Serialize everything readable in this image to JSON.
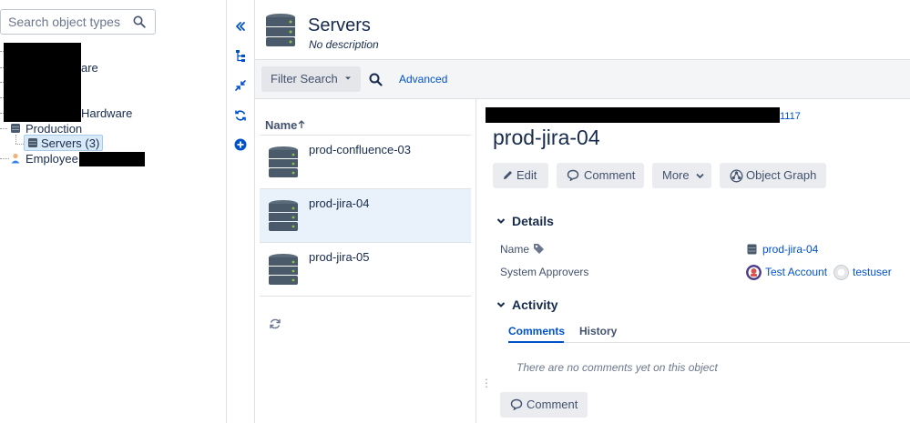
{
  "tree": {
    "search_placeholder": "Search object types",
    "nodes": {
      "partial_1": "are",
      "partial_2": "Hardware",
      "production": "Production",
      "servers": "Servers (3)",
      "employee": "Employee"
    }
  },
  "icon_column": {
    "icons": [
      "collapse-left-icon",
      "hierarchy-icon",
      "compress-icon",
      "sync-icon",
      "add-circle-icon"
    ]
  },
  "header": {
    "title": "Servers",
    "description": "No description"
  },
  "filter_bar": {
    "filter_label": "Filter Search",
    "advanced_label": "Advanced"
  },
  "list": {
    "column_header": "Name",
    "items": [
      {
        "label": "prod-confluence-03"
      },
      {
        "label": "prod-jira-04"
      },
      {
        "label": "prod-jira-05"
      }
    ]
  },
  "detail": {
    "key_suffix": "1117",
    "title": "prod-jira-04",
    "buttons": {
      "edit": "Edit",
      "comment": "Comment",
      "more": "More",
      "object_graph": "Object Graph"
    },
    "details_section": {
      "title": "Details",
      "name_label": "Name",
      "name_value": "prod-jira-04",
      "approvers_label": "System Approvers",
      "approver_1": "Test Account",
      "approver_2": "testuser"
    },
    "activity_section": {
      "title": "Activity",
      "tab_comments": "Comments",
      "tab_history": "History",
      "empty_text": "There are no comments yet on this object",
      "comment_button": "Comment"
    }
  },
  "colors": {
    "link": "#0052cc",
    "selected_row": "#e9f2fb",
    "server_icon": "#4a5a6a",
    "server_light": "#8bc34a"
  }
}
